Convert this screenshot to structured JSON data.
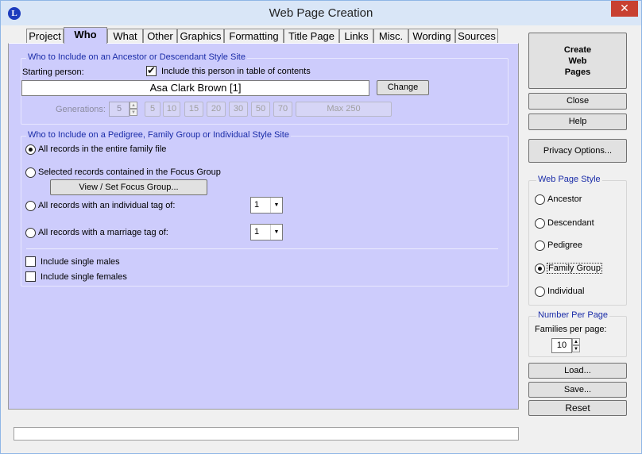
{
  "window": {
    "title": "Web Page Creation",
    "app_icon_letter": "L",
    "close_symbol": "✕"
  },
  "tabs": [
    {
      "label": "Project",
      "active": false
    },
    {
      "label": "Who",
      "active": true
    },
    {
      "label": "What",
      "active": false
    },
    {
      "label": "Other",
      "active": false
    },
    {
      "label": "Graphics",
      "active": false
    },
    {
      "label": "Formatting",
      "active": false
    },
    {
      "label": "Title Page",
      "active": false
    },
    {
      "label": "Links",
      "active": false
    },
    {
      "label": "Misc.",
      "active": false
    },
    {
      "label": "Wording",
      "active": false
    },
    {
      "label": "Sources",
      "active": false
    }
  ],
  "ancestor": {
    "group_title": "Who to Include on an Ancestor or Descendant Style Site",
    "starting_person_label": "Starting person:",
    "include_toc_label": "Include this person in table of contents",
    "include_toc_checked": true,
    "starting_person_value": "Asa Clark Brown [1]",
    "change_button": "Change",
    "generations_label": "Generations:",
    "generations_value": "5",
    "generation_buttons": [
      "5",
      "10",
      "15",
      "20",
      "30",
      "50",
      "70"
    ],
    "max_button": "Max 250"
  },
  "pedigree": {
    "group_title": "Who to Include on a Pedigree, Family Group or Individual Style Site",
    "opt_all_records": "All records in the entire family file",
    "opt_selected_records": "Selected records contained in the Focus Group",
    "view_focus_button": "View / Set Focus Group...",
    "opt_individual_tag": "All records with an individual tag of:",
    "individual_tag_value": "1",
    "opt_marriage_tag": "All records with a marriage tag of:",
    "marriage_tag_value": "1",
    "selected_option": "all_records",
    "include_single_males": "Include single males",
    "include_single_females": "Include single females"
  },
  "sidebar": {
    "create_button": [
      "Create",
      "Web",
      "Pages"
    ],
    "close_button": "Close",
    "help_button": "Help",
    "privacy_button": "Privacy Options...",
    "style_group_title": "Web Page Style",
    "styles": [
      "Ancestor",
      "Descendant",
      "Pedigree",
      "Family Group",
      "Individual"
    ],
    "selected_style": "Family Group",
    "number_group_title": "Number Per Page",
    "families_label": "Families per page:",
    "families_value": "10",
    "load_button": "Load...",
    "save_button": "Save...",
    "reset_button": "Reset"
  },
  "status_text": ""
}
